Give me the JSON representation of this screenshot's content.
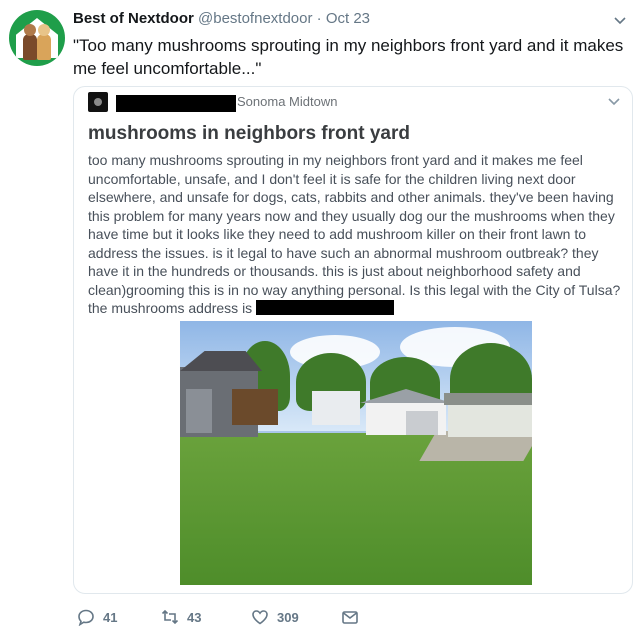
{
  "tweet": {
    "display_name": "Best of Nextdoor",
    "handle": "@bestofnextdoor",
    "separator": "·",
    "date": "Oct 23",
    "text": "\"Too many mushrooms sprouting in my neighbors front yard and it makes me feel uncomfortable...\""
  },
  "quoted_post": {
    "neighborhood": "Sonoma Midtown",
    "title": "mushrooms in neighbors front yard",
    "body": "too many mushrooms sprouting in my neighbors front yard and it makes me feel uncomfortable, unsafe, and I don't feel it is safe for the children living next door elsewhere, and unsafe for dogs, cats, rabbits and other animals. they've been having this problem for many years  now and they usually dog our the mushrooms when they have time but it looks like they need to add mushroom killer on their front lawn to address the issues. is it legal to have such an abnormal mushroom outbreak? they have it in the hundreds or thousands. this is just about neighborhood safety and clean)grooming this is in no way anything personal. Is this legal with the City of Tulsa? the mushrooms address is"
  },
  "actions": {
    "replies": "41",
    "retweets": "43",
    "likes": "309"
  },
  "colors": {
    "accent_green": "#1f9e4a",
    "muted_text": "#657786",
    "border": "#e1e8ed"
  }
}
